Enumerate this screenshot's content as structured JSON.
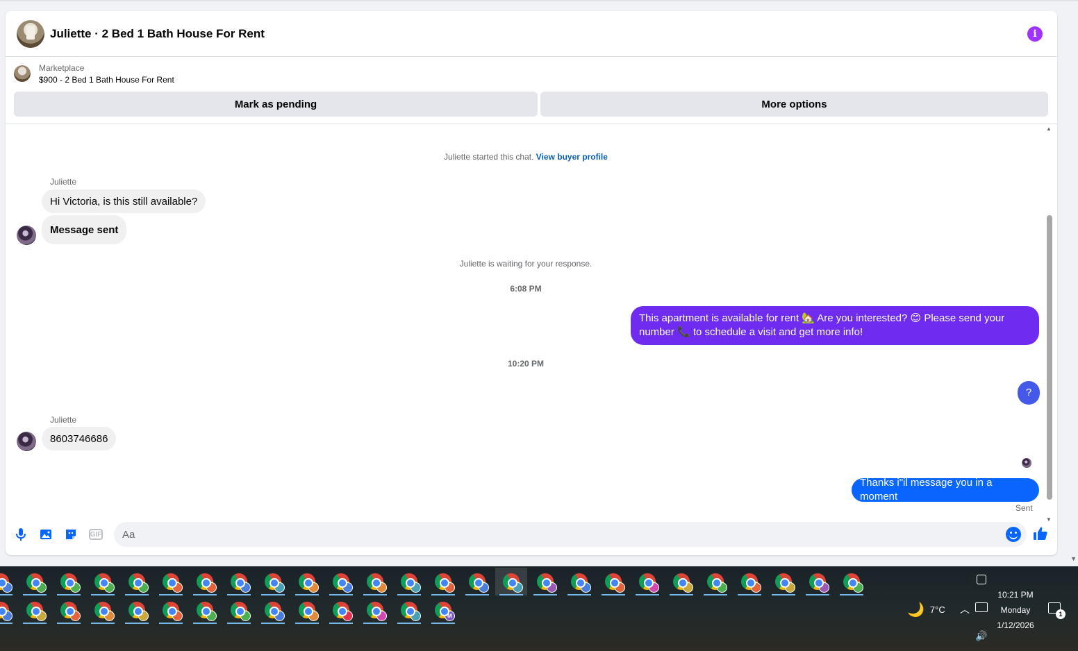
{
  "header": {
    "title": "Juliette · 2 Bed 1 Bath House For Rent",
    "info_icon": "info-icon"
  },
  "listing": {
    "label": "Marketplace",
    "price_title": "$900 - 2 Bed 1 Bath House For Rent"
  },
  "actions": {
    "mark_pending": "Mark as pending",
    "more_options": "More options"
  },
  "thread": {
    "started_text": "Juliette started this chat.",
    "view_profile": "View buyer profile",
    "messages": [
      {
        "sender": "Juliette",
        "text": "Hi Victoria, is this still available?"
      },
      {
        "text": "Message sent"
      }
    ],
    "waiting_text": "Juliette is waiting for your response.",
    "time_1": "6:08 PM",
    "outgoing_1": "This apartment is available for rent 🏡 Are you interested? 😊 Please send your number 📞 to schedule a visit and get more info!",
    "time_2": "10:20 PM",
    "outgoing_2": "?",
    "reply_sender": "Juliette",
    "reply_text": "8603746686",
    "outgoing_3": "Thanks i\"il message you in a moment",
    "sent_status": "Sent"
  },
  "composer": {
    "placeholder": "Aa",
    "icons": [
      "microphone-icon",
      "photo-icon",
      "sticker-icon",
      "gif-icon",
      "emoji-icon",
      "like-icon"
    ],
    "gif_label": "GIF"
  },
  "taskbar": {
    "row1_badges": [
      "#4a7fd9",
      "#4caf50",
      "#4caf50",
      "#4caf50",
      "#4caf50",
      "#e0643c",
      "#e0643c",
      "#4a7fd9",
      "#4a9fb5",
      "#e08a3c",
      "#4a7fd9",
      "#e08a3c",
      "#4a9fb5",
      "#e0643c",
      "#4a7fd9",
      "#4a9fb5",
      "#9b59b6",
      "#4a7fd9",
      "#e0643c",
      "#d14ab0",
      "#c9a83c",
      "#4caf50",
      "#e0643c",
      "#c9a83c",
      "#9b59b6",
      "#4caf50"
    ],
    "row2_badges": [
      "#4a7fd9",
      "#c9a83c",
      "#e0643c",
      "#e08a3c",
      "#c9a83c",
      "#e0643c",
      "#4caf50",
      "#4caf50",
      "#4a7fd9",
      "#e08a3c",
      "#e0354a",
      "#d14ab0",
      "#4a9fb5",
      "#7e57c2"
    ],
    "row2_last_label": "M",
    "weather_temp": "7°C",
    "clock_time": "10:21 PM",
    "clock_day": "Monday",
    "clock_date": "1/12/2026",
    "notification_count": "1"
  },
  "colors": {
    "outgoing_purple": "#6f2bef",
    "outgoing_blue": "#0866ff",
    "link_blue": "#0a5fb4",
    "info_purple": "#a033ff"
  }
}
